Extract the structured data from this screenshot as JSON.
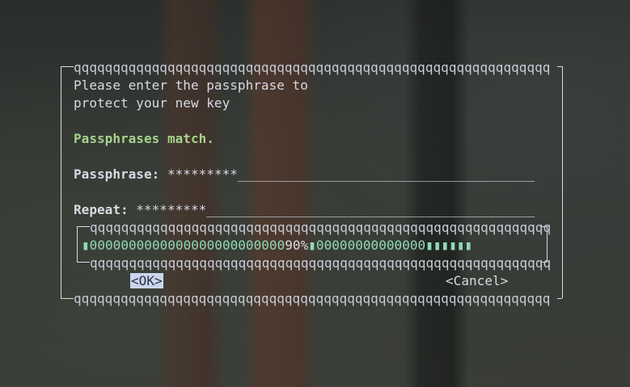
{
  "dialog": {
    "border_top": "qqqqqqqqqqqqqqqqqqqqqqqqqqqqqqqqqqqqqqqqqqqqqqqqqqqqqqqqqqqqq",
    "border_bottom": "qqqqqqqqqqqqqqqqqqqqqqqqqqqqqqqqqqqqqqqqqqqqqqqqqqqqqqqqqqqqq",
    "prompt_line1": "Please enter the passphrase to",
    "prompt_line2": "protect your new key",
    "status": "Passphrases match.",
    "passphrase_label": "Passphrase:",
    "passphrase_value": "*********",
    "passphrase_fill": "______________________________________",
    "repeat_label": "Repeat:",
    "repeat_value": "*********",
    "repeat_fill": "__________________________________________"
  },
  "quality_meter": {
    "border_top": "qqqqqqqqqqqqqqqqqqqqqqqqqqqqqqqqqqqqqqqqqqqqqqqqqqqqqqqqqqq",
    "border_bottom": "qqqqqqqqqqqqqqqqqqqqqqqqqqqqqqqqqqqqqqqqqqqqqqqqqqqqqqqqqqq",
    "left_cap": "▮",
    "fill_left": "0000000000000000000000000",
    "percent": "90%",
    "mid_cap": "▮",
    "fill_right": "00000000000000",
    "tail": "▮▮▮▮▮▮",
    "value": 0.9
  },
  "buttons": {
    "ok": "<OK>",
    "cancel": "<Cancel>"
  },
  "colors": {
    "status_green": "#a6d38b",
    "button_focus_bg": "#c9d6ef",
    "meter_fill": "#8fd9b5"
  }
}
